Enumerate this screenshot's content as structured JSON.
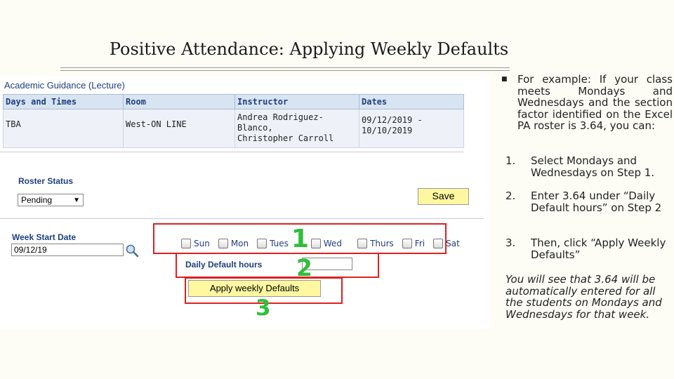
{
  "slide": {
    "title": "Positive Attendance: Applying Weekly Defaults"
  },
  "screen": {
    "course_title": "Academic Guidance (Lecture)",
    "table": {
      "headers": [
        "Days and Times",
        "Room",
        "Instructor",
        "Dates"
      ],
      "row": [
        "TBA",
        "West-ON LINE",
        "Andrea Rodriguez-Blanco,\nChristopher Carroll",
        "09/12/2019 -\n10/10/2019"
      ]
    },
    "roster_status": {
      "label": "Roster Status",
      "value": "Pending"
    },
    "save_label": "Save",
    "week_start": {
      "label": "Week Start Date",
      "value": "09/12/19"
    },
    "days": [
      "Sun",
      "Mon",
      "Tues",
      "Wed",
      "Thurs",
      "Fri",
      "Sat"
    ],
    "daily_default_label": "Daily Default hours",
    "daily_default_value": "",
    "apply_label": "Apply weekly Defaults",
    "markers": [
      "1",
      "2",
      "3"
    ],
    "accent_red": "#e02020",
    "marker_green": "#2fbf3a"
  },
  "notes": {
    "bullet": "For example: If your class meets Mondays and Wednesdays and the section factor identified on the Excel PA roster is 3.64, you can:",
    "steps": [
      {
        "n": "1.",
        "text": "Select Mondays and Wednesdays on Step 1."
      },
      {
        "n": "2.",
        "text": "Enter 3.64 under “Daily Default hours” on Step 2"
      },
      {
        "n": "3.",
        "text": "Then, click “Apply Weekly Defaults”"
      }
    ],
    "outro": "You will see that 3.64 will be automatically entered for all the students on Mondays and Wednesdays for that week."
  }
}
